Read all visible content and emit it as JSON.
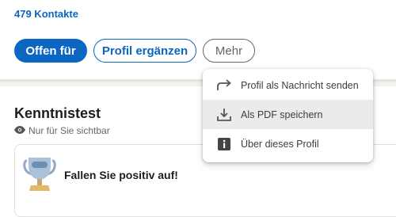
{
  "profile": {
    "contacts_text": "479 Kontakte"
  },
  "actions": {
    "open_for": "Offen für",
    "complete_profile": "Profil ergänzen",
    "more": "Mehr"
  },
  "skills_section": {
    "title": "Kenntnistest",
    "visibility": "Nur für Sie sichtbar",
    "card_text": "Fallen Sie positiv auf!"
  },
  "more_menu": {
    "items": [
      {
        "label": "Profil als Nachricht senden",
        "icon": "share-arrow-icon"
      },
      {
        "label": "Als PDF speichern",
        "icon": "download-icon"
      },
      {
        "label": "Über dieses Profil",
        "icon": "info-icon"
      }
    ]
  },
  "colors": {
    "brand_blue": "#0a66c2",
    "text_dark": "#1d1d1d",
    "text_muted": "#666666"
  }
}
